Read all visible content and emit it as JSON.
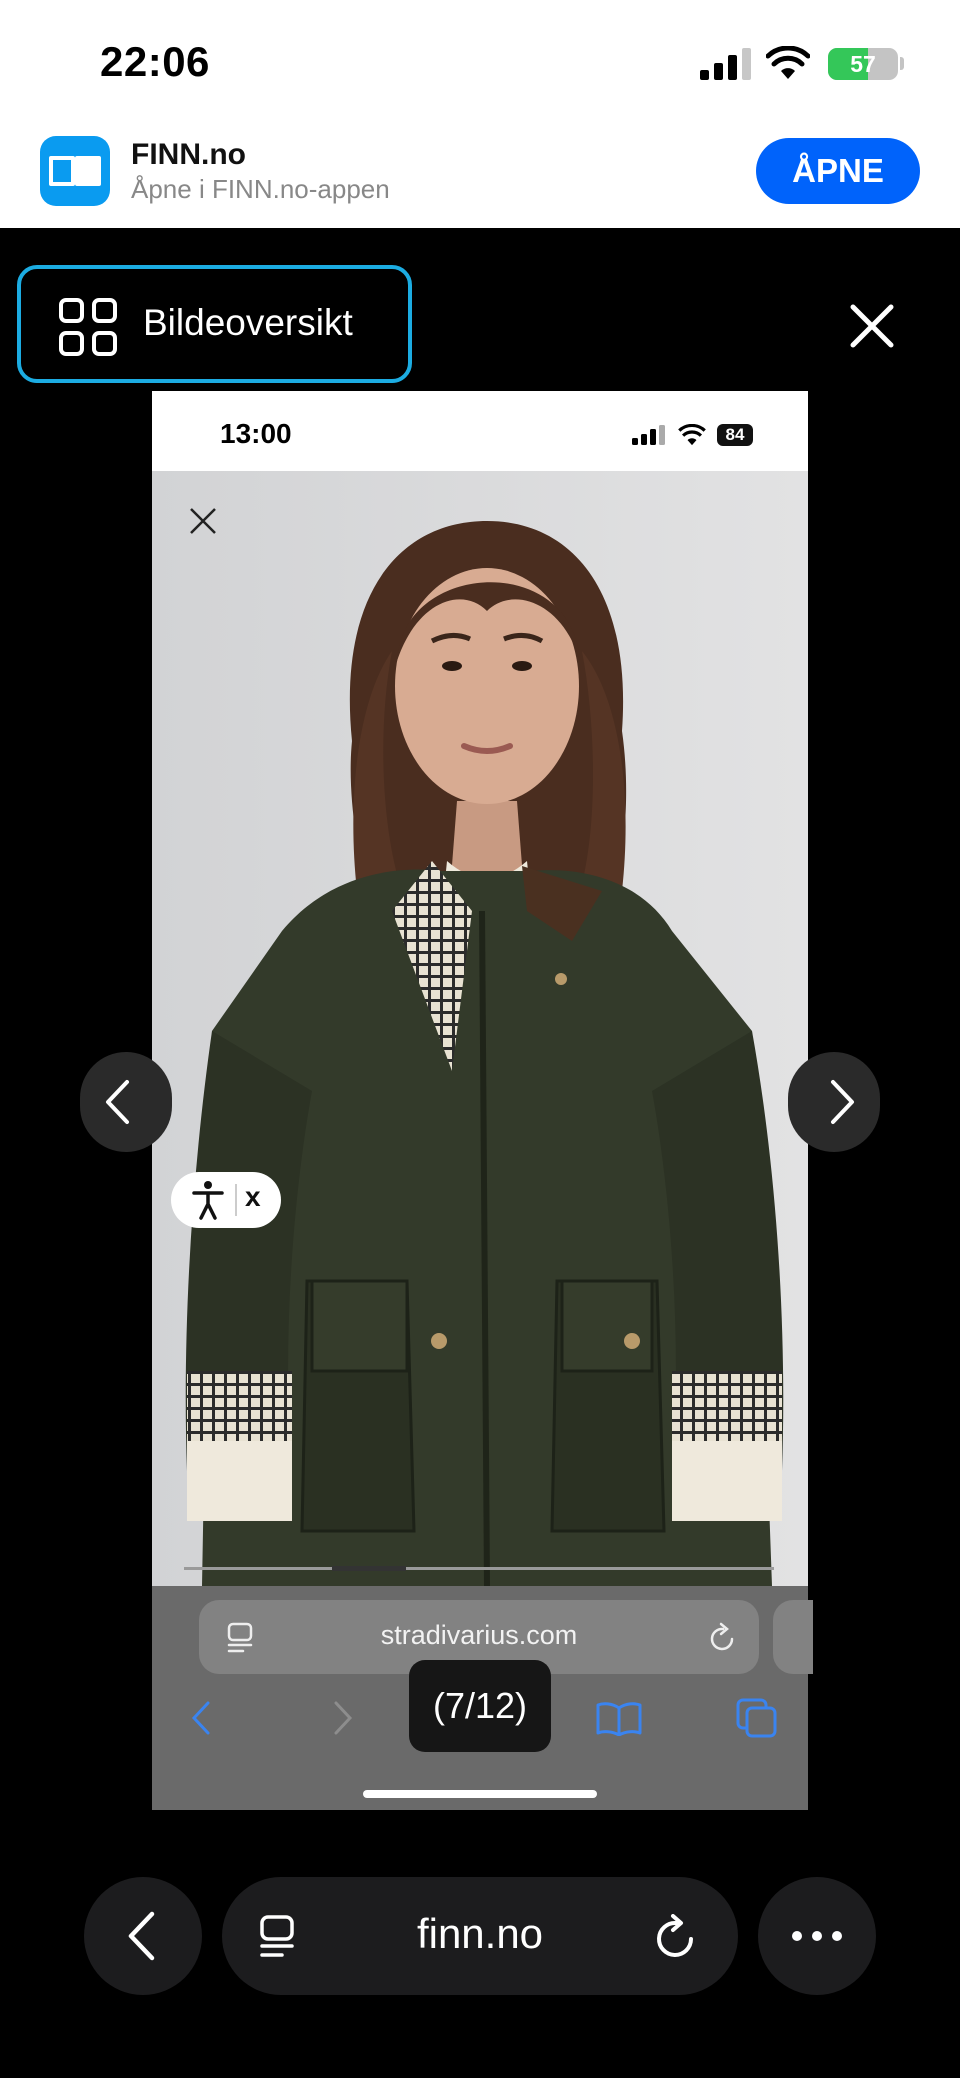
{
  "status_bar": {
    "time": "22:06",
    "battery": "57",
    "battery_level": 0.57
  },
  "app_banner": {
    "name": "FINN.no",
    "subtitle": "Åpne i FINN.no-appen",
    "open_label": "ÅPNE"
  },
  "gallery": {
    "overview_label": "Bildeoversikt",
    "counter": "(7/12)",
    "current_image": 7,
    "total_images": 12
  },
  "embedded_screenshot": {
    "time": "13:00",
    "battery": "84",
    "url": "stradivarius.com",
    "accessibility_close": "x",
    "slide_progress": 0.33
  },
  "browser": {
    "url": "finn.no"
  },
  "colors": {
    "accent_blue": "#0063fb",
    "focus_ring": "#1cace2",
    "banner_icon": "#0a9bf0",
    "battery_green": "#34c759"
  },
  "icons": [
    "signal-icon",
    "wifi-icon",
    "book-icon",
    "grid-icon",
    "close-icon",
    "chevron-left-icon",
    "chevron-right-icon",
    "reader-icon",
    "reload-icon",
    "share-icon",
    "bookmarks-icon",
    "tabs-icon",
    "accessibility-icon",
    "more-icon"
  ]
}
